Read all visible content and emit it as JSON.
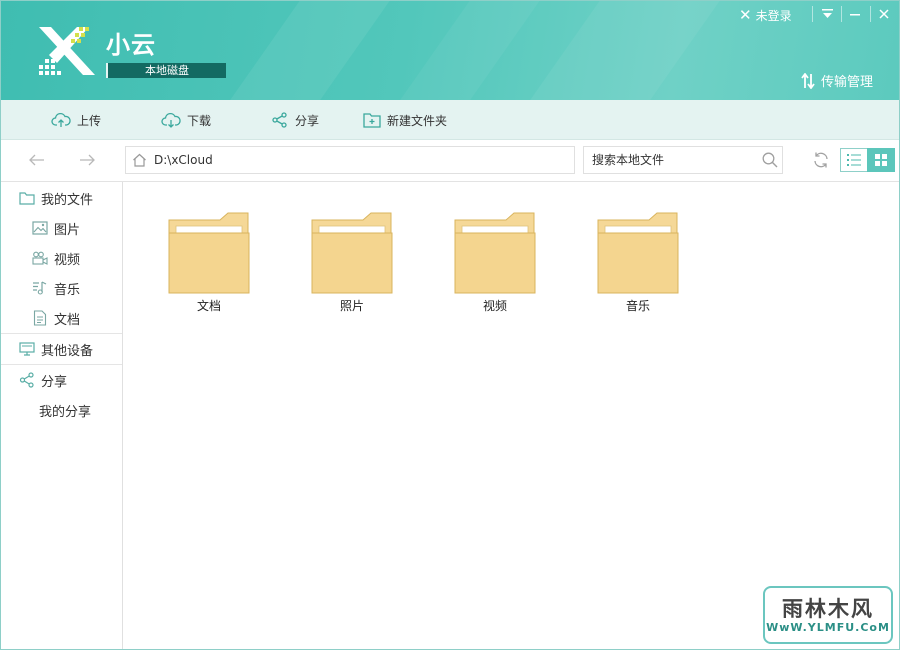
{
  "app": {
    "title": "小云",
    "disk_label": "本地磁盘"
  },
  "titlebar": {
    "login_text": "未登录",
    "transfer_label": "传输管理"
  },
  "toolbar": {
    "upload": "上传",
    "download": "下载",
    "share": "分享",
    "new_folder": "新建文件夹"
  },
  "address": {
    "path": "D:\\xCloud",
    "search_placeholder": "搜索本地文件"
  },
  "sidebar": {
    "my_files": "我的文件",
    "pictures": "图片",
    "videos": "视频",
    "music": "音乐",
    "documents": "文档",
    "other_devices": "其他设备",
    "share": "分享",
    "my_shares": "我的分享"
  },
  "folders": [
    {
      "name": "文档"
    },
    {
      "name": "照片"
    },
    {
      "name": "视频"
    },
    {
      "name": "音乐"
    }
  ],
  "watermark": {
    "big": "雨林木风",
    "small": "WwW.YLMFU.CoM"
  },
  "colors": {
    "accent": "#4cc3b7",
    "folder": "#f5d897",
    "folder_border": "#d9b45e",
    "badge": "#136a62"
  }
}
